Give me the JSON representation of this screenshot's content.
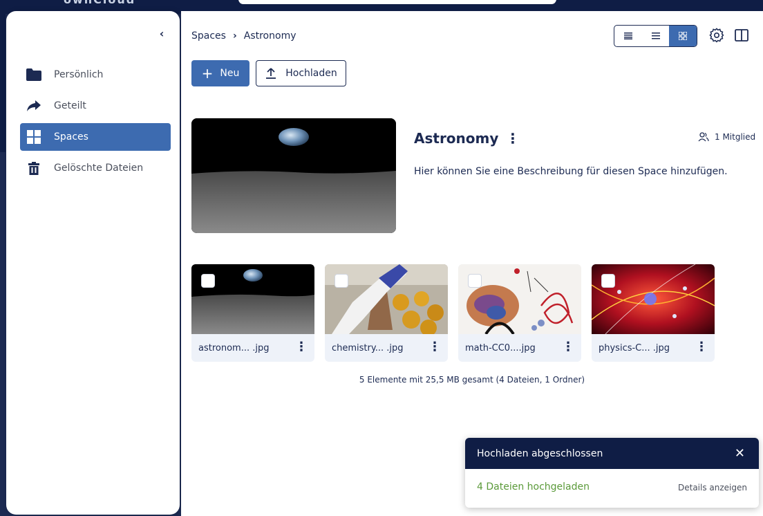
{
  "app": {
    "brand": "ownCloud"
  },
  "colors": {
    "accent": "#3d6bb0",
    "navy": "#0f1d45",
    "success": "#5b9a3a"
  },
  "sidebar": {
    "items": [
      {
        "label": "Persönlich",
        "icon": "folder-icon"
      },
      {
        "label": "Geteilt",
        "icon": "share-icon"
      },
      {
        "label": "Spaces",
        "icon": "grid-icon",
        "active": true
      },
      {
        "label": "Gelöschte Dateien",
        "icon": "trash-icon"
      }
    ]
  },
  "breadcrumb": {
    "root": "Spaces",
    "current": "Astronomy"
  },
  "toolbar": {
    "new_label": "Neu",
    "upload_label": "Hochladen"
  },
  "space": {
    "title": "Astronomy",
    "members": "1 Mitglied",
    "description": "Hier können Sie eine Beschreibung für diesen Space hinzufügen."
  },
  "files": [
    {
      "name": "astronom... .jpg",
      "thumb": "moon-earthrise"
    },
    {
      "name": "chemistry... .jpg",
      "thumb": "lab-flask"
    },
    {
      "name": "math-CC0....jpg",
      "thumb": "math-shapes"
    },
    {
      "name": "physics-C... .jpg",
      "thumb": "particle-rays"
    }
  ],
  "summary": "5 Elemente mit 25,5 MB gesamt (4 Dateien, 1 Ordner)",
  "toast": {
    "title": "Hochladen abgeschlossen",
    "message": "4 Dateien hochgeladen",
    "details": "Details anzeigen"
  }
}
